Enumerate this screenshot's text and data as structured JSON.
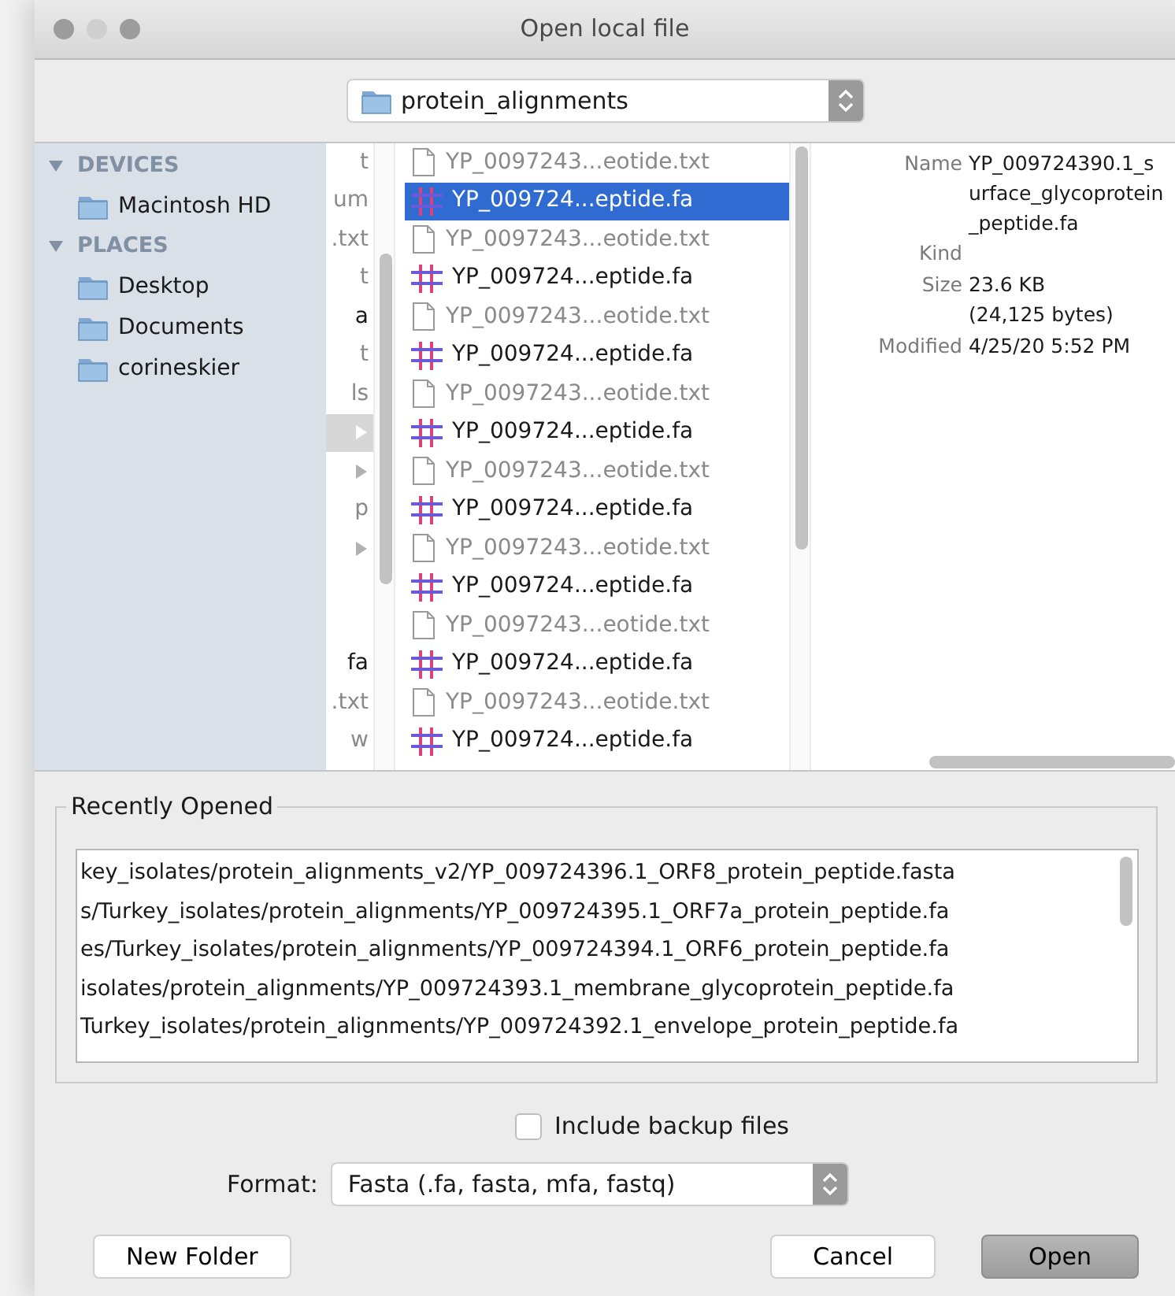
{
  "window": {
    "title": "Open local file"
  },
  "location": {
    "value": "protein_alignments"
  },
  "sidebar": {
    "sections": [
      {
        "label": "DEVICES",
        "expanded": true,
        "items": [
          {
            "label": "Macintosh HD"
          }
        ]
      },
      {
        "label": "PLACES",
        "expanded": true,
        "items": [
          {
            "label": "Desktop"
          },
          {
            "label": "Documents"
          },
          {
            "label": "corineskier"
          }
        ]
      }
    ]
  },
  "parent_column": {
    "rows": [
      {
        "kind": "txt",
        "text": "t"
      },
      {
        "kind": "txt",
        "text": "um"
      },
      {
        "kind": "txt",
        "text": ".txt"
      },
      {
        "kind": "txt",
        "text": "t"
      },
      {
        "kind": "fa",
        "text": "a"
      },
      {
        "kind": "txt",
        "text": "t"
      },
      {
        "kind": "txt",
        "text": "ls"
      },
      {
        "kind": "folder",
        "selected": true
      },
      {
        "kind": "folder",
        "selected": false
      },
      {
        "kind": "txt",
        "text": "p"
      },
      {
        "kind": "folder",
        "selected": false
      },
      {
        "kind": "blank"
      },
      {
        "kind": "blank"
      },
      {
        "kind": "fa",
        "text": "fa"
      },
      {
        "kind": "txt",
        "text": ".txt"
      },
      {
        "kind": "txt",
        "text": "w"
      }
    ]
  },
  "files": [
    {
      "kind": "txt",
      "name": "YP_0097243...eotide.txt",
      "selected": false
    },
    {
      "kind": "fa",
      "name": "YP_009724...eptide.fa",
      "selected": true
    },
    {
      "kind": "txt",
      "name": "YP_0097243...eotide.txt",
      "selected": false
    },
    {
      "kind": "fa",
      "name": "YP_009724...eptide.fa",
      "selected": false
    },
    {
      "kind": "txt",
      "name": "YP_0097243...eotide.txt",
      "selected": false
    },
    {
      "kind": "fa",
      "name": "YP_009724...eptide.fa",
      "selected": false
    },
    {
      "kind": "txt",
      "name": "YP_0097243...eotide.txt",
      "selected": false
    },
    {
      "kind": "fa",
      "name": "YP_009724...eptide.fa",
      "selected": false
    },
    {
      "kind": "txt",
      "name": "YP_0097243...eotide.txt",
      "selected": false
    },
    {
      "kind": "fa",
      "name": "YP_009724...eptide.fa",
      "selected": false
    },
    {
      "kind": "txt",
      "name": "YP_0097243...eotide.txt",
      "selected": false
    },
    {
      "kind": "fa",
      "name": "YP_009724...eptide.fa",
      "selected": false
    },
    {
      "kind": "txt",
      "name": "YP_0097243...eotide.txt",
      "selected": false
    },
    {
      "kind": "fa",
      "name": "YP_009724...eptide.fa",
      "selected": false
    },
    {
      "kind": "txt",
      "name": "YP_0097243...eotide.txt",
      "selected": false
    },
    {
      "kind": "fa",
      "name": "YP_009724...eptide.fa",
      "selected": false
    }
  ],
  "preview": [
    {
      "label": "Name",
      "lines": [
        "YP_009724390.1_s",
        "urface_glycoprotein",
        "_peptide.fa"
      ]
    },
    {
      "label": "Kind"
    },
    {
      "label": "Size",
      "lines": [
        "23.6 KB",
        "(24,125 bytes)"
      ]
    },
    {
      "label": "Modified",
      "lines": [
        "4/25/20 5:52 PM"
      ]
    }
  ],
  "recently_opened": {
    "title": "Recently Opened",
    "items": [
      "key_isolates/protein_alignments_v2/YP_009724396.1_ORF8_protein_peptide.fasta",
      "s/Turkey_isolates/protein_alignments/YP_009724395.1_ORF7a_protein_peptide.fa",
      "es/Turkey_isolates/protein_alignments/YP_009724394.1_ORF6_protein_peptide.fa",
      "isolates/protein_alignments/YP_009724393.1_membrane_glycoprotein_peptide.fa",
      "Turkey_isolates/protein_alignments/YP_009724392.1_envelope_protein_peptide.fa"
    ]
  },
  "include_backup": {
    "label": "Include backup files",
    "checked": false
  },
  "format": {
    "label": "Format:",
    "value": "Fasta (.fa, fasta, mfa, fastq)"
  },
  "buttons": [
    {
      "label": "New Folder",
      "kind": "plain"
    },
    {
      "label": "Cancel",
      "kind": "plain"
    },
    {
      "label": "Open",
      "kind": "default"
    }
  ]
}
